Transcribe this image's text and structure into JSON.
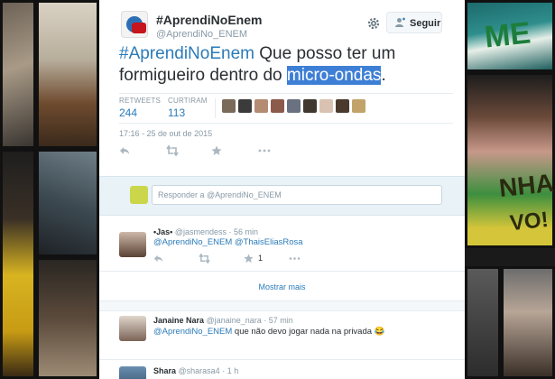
{
  "tweet": {
    "display_name": "#AprendiNoEnem",
    "handle": "@AprendiNo_ENEM",
    "follow_label": "Seguir",
    "text_hashtag": "#AprendiNoEnem",
    "text_middle": " Que posso ter um formigueiro dentro do ",
    "text_highlight": "micro-ondas",
    "text_end": ".",
    "retweets_label": "RETWEETS",
    "retweets_count": "244",
    "likes_label": "CURTIRAM",
    "likes_count": "113",
    "timestamp": "17:16 - 25 de out de 2015"
  },
  "reply_box": {
    "placeholder": "Responder a @AprendiNo_ENEM"
  },
  "replies": [
    {
      "name": "•Jas•",
      "handle": "@jasmendess",
      "time": "· 56 min",
      "mention": "@AprendiNo_ENEM @ThaisEliasRosa",
      "text": "",
      "like_count": "1"
    },
    {
      "name": "Janaine Nara",
      "handle": "@janaine_nara",
      "time": "· 57 min",
      "mention": "@AprendiNo_ENEM",
      "text": " que não devo jogar nada na privada 😂",
      "like_count": ""
    },
    {
      "name": "Shara",
      "handle": "@sharasa4",
      "time": "· 1 h",
      "mention": "",
      "text": "",
      "like_count": ""
    }
  ],
  "show_more_label": "Mostrar mais",
  "background_text": {
    "left_sign": "ME",
    "right_sign": "NHA",
    "bottom_sign": "VO!"
  },
  "colors": {
    "link": "#2b7bb9",
    "highlight": "#3e7fd6",
    "muted": "#8899a6"
  }
}
